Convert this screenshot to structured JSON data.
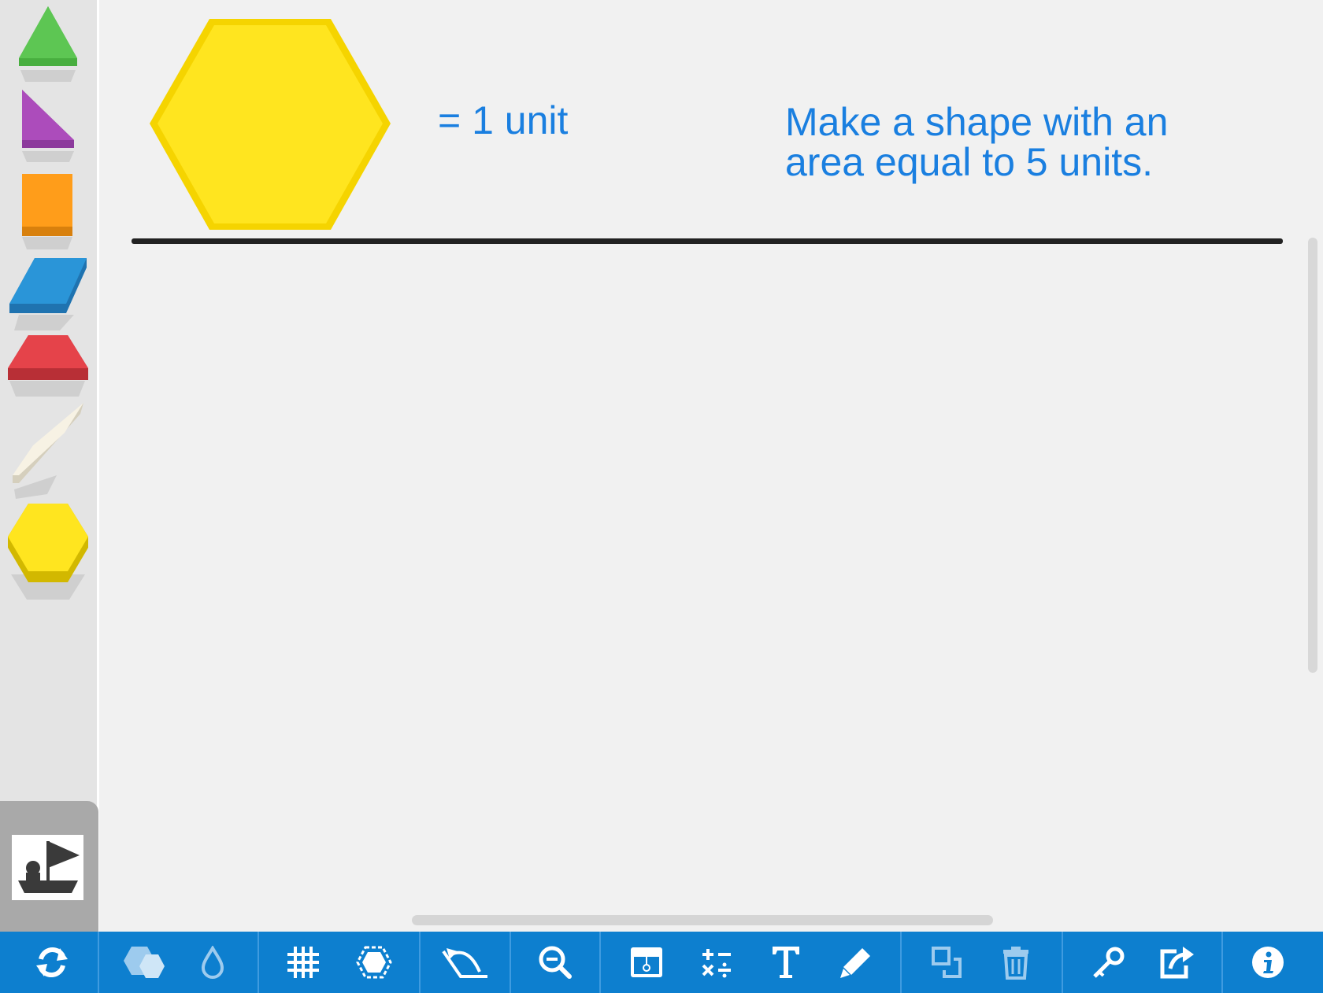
{
  "canvas": {
    "unit_label": "= 1 unit",
    "instruction": "Make a shape with an area equal to 5 units."
  },
  "tray": {
    "shapes": [
      {
        "name": "triangle",
        "color": "#5dc653"
      },
      {
        "name": "right-triangle",
        "color": "#ac4cbb"
      },
      {
        "name": "square",
        "color": "#ff9d1a"
      },
      {
        "name": "blue-rhombus",
        "color": "#2a95d8"
      },
      {
        "name": "trapezoid",
        "color": "#e5434a"
      },
      {
        "name": "thin-rhombus",
        "color": "#f7f2e4"
      },
      {
        "name": "hexagon",
        "color": "#ffe51f"
      }
    ],
    "stamp_icon": "stamp-icon"
  },
  "toolbar": {
    "color": "#0d7fcf",
    "icons": [
      "refresh-icon",
      "shapes-icon",
      "fill-color-icon",
      "grid-icon",
      "hexagon-select-icon",
      "rotate-icon",
      "zoom-out-icon",
      "screen-icon",
      "math-symbols-icon",
      "text-icon",
      "pencil-icon",
      "duplicate-icon",
      "trash-icon",
      "key-icon",
      "share-icon",
      "info-icon"
    ]
  },
  "colors": {
    "accent_text": "#1a7fe0",
    "reference_hexagon": "#ffe51f"
  }
}
